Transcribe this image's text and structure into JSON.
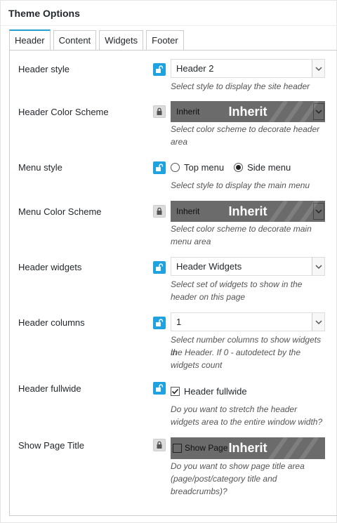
{
  "panel": {
    "title": "Theme Options"
  },
  "tabs": [
    {
      "label": "Header",
      "active": true
    },
    {
      "label": "Content",
      "active": false
    },
    {
      "label": "Widgets",
      "active": false
    },
    {
      "label": "Footer",
      "active": false
    }
  ],
  "colors": {
    "accent": "#1ea2e0",
    "locked_overlay": "#6b6b6b",
    "tab_active_border": "#23a0d0"
  },
  "options": {
    "header_style": {
      "label": "Header style",
      "value": "Header 2",
      "description": "Select style to display the site header",
      "inherit_state": "unlocked"
    },
    "header_color_scheme": {
      "label": "Header Color Scheme",
      "value": "Inherit",
      "overlay_text": "Inherit",
      "description_line1": "Select color scheme to decorate header",
      "description_line2": "area",
      "inherit_state": "locked"
    },
    "menu_style": {
      "label": "Menu style",
      "option_top": "Top menu",
      "option_side": "Side menu",
      "selected": "Side menu",
      "description": "Select style to display the main menu",
      "inherit_state": "unlocked"
    },
    "menu_color_scheme": {
      "label": "Menu Color Scheme",
      "value": "Inherit",
      "overlay_text": "Inherit",
      "description_line1": "Select color scheme to decorate main",
      "description_line2": "menu area",
      "inherit_state": "locked"
    },
    "header_widgets": {
      "label": "Header widgets",
      "value": "Header Widgets",
      "description_line1": "Select set of widgets to show in the",
      "description_line2": "header on this page",
      "inherit_state": "unlocked"
    },
    "header_columns": {
      "label": "Header columns",
      "value": "1",
      "description_line1": "Select number columns to show widgets in",
      "description_line2": "the Header. If 0 - autodetect by the",
      "description_line3": "widgets count",
      "inherit_state": "unlocked"
    },
    "header_fullwide": {
      "label": "Header fullwide",
      "checkbox_label": "Header fullwide",
      "checked": true,
      "description_line1": "Do you want to stretch the header",
      "description_line2": "widgets area to the entire window width?",
      "inherit_state": "unlocked"
    },
    "show_page_title": {
      "label": "Show Page Title",
      "checkbox_label": "Show Page",
      "overlay_text": "Inherit",
      "description_line1": "Do you want to show page title area",
      "description_line2": "(page/post/category title and",
      "description_line3": "breadcrumbs)?",
      "inherit_state": "locked"
    }
  }
}
